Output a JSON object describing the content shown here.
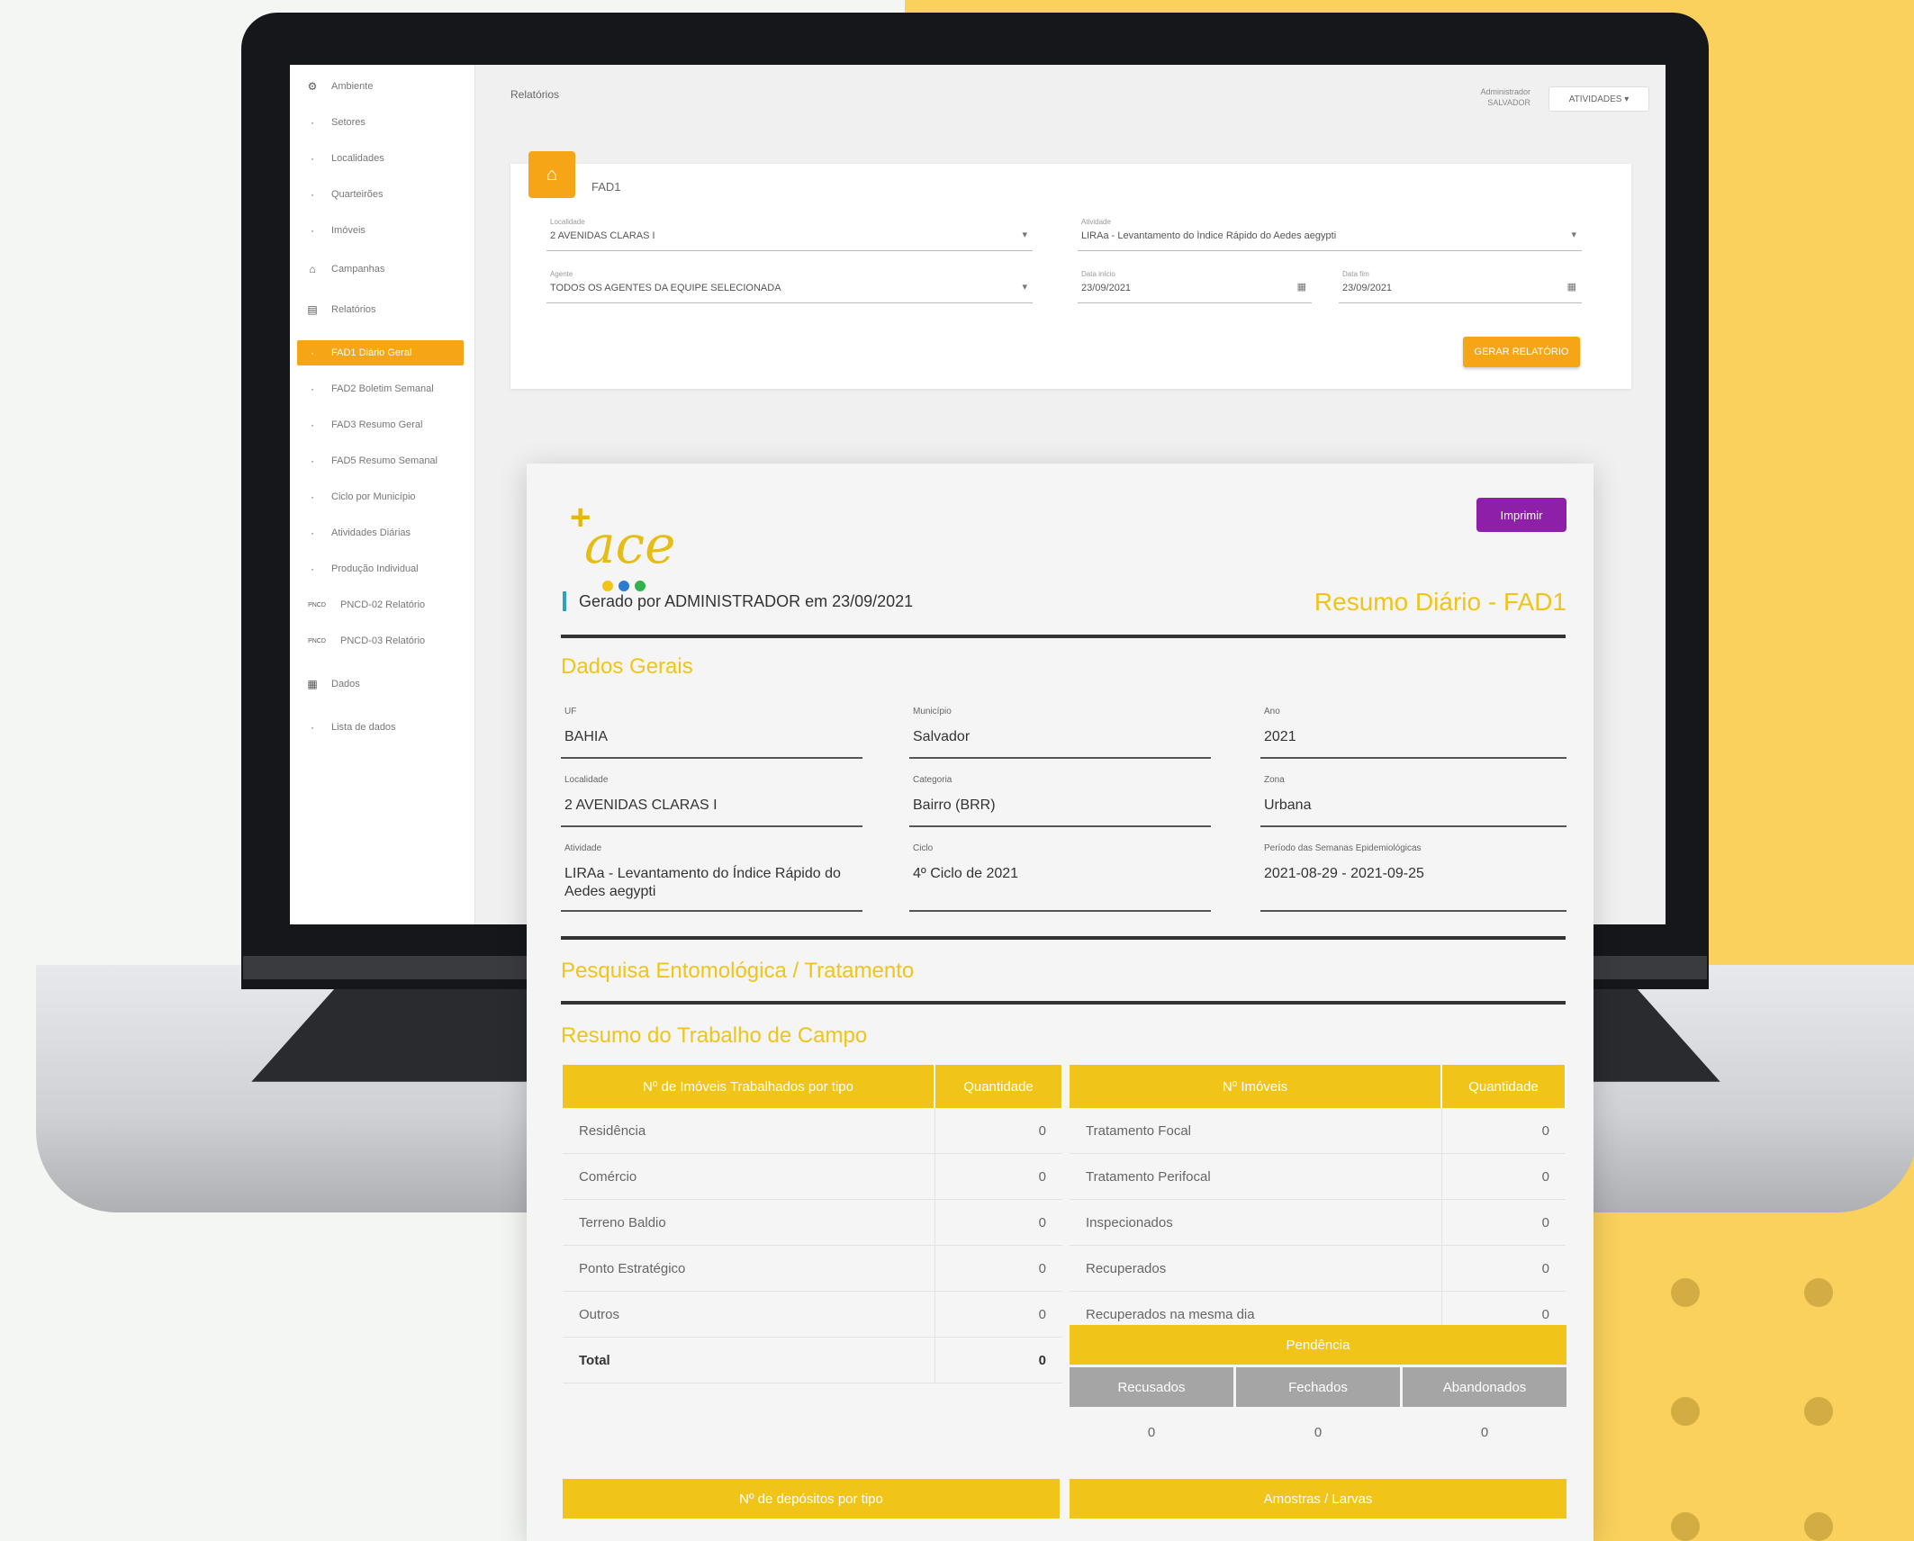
{
  "colors": {
    "accent": "#f6a516",
    "report_yellow": "#f0c419",
    "print": "#8e1fa8",
    "background_yellow": "#fad15c"
  },
  "sidebar": {
    "items": [
      {
        "icon": "gear-icon",
        "label": "Ambiente"
      },
      {
        "icon": "dot",
        "label": "Setores"
      },
      {
        "icon": "dot",
        "label": "Localidades"
      },
      {
        "icon": "dot",
        "label": "Quarteirões"
      },
      {
        "icon": "dot",
        "label": "Imóveis"
      },
      {
        "icon": "home-icon",
        "label": "Campanhas"
      },
      {
        "icon": "calendar-icon",
        "label": "Relatórios"
      },
      {
        "icon": "dot",
        "label": "FAD1 Diário Geral"
      },
      {
        "icon": "dot",
        "label": "FAD2 Boletim Semanal"
      },
      {
        "icon": "dot",
        "label": "FAD3 Resumo Geral"
      },
      {
        "icon": "dot",
        "label": "FAD5 Resumo Semanal"
      },
      {
        "icon": "dot",
        "label": "Ciclo por Município"
      },
      {
        "icon": "dot",
        "label": "Atividades Diárias"
      },
      {
        "icon": "dot",
        "label": "Produção Individual"
      },
      {
        "icon": "PNCD",
        "label": "PNCD-02 Relatório"
      },
      {
        "icon": "PNCD",
        "label": "PNCD-03 Relatório"
      },
      {
        "icon": "table-icon",
        "label": "Dados"
      },
      {
        "icon": "dot",
        "label": "Lista de dados"
      }
    ],
    "active_index": 7
  },
  "topbar": {
    "breadcrumb": "Relatórios",
    "user_line1": "Administrador",
    "user_line2": "SALVADOR",
    "user_button": "ATIVIDADES ▾"
  },
  "filter": {
    "title": "FAD1",
    "f1_label": "Localidade",
    "f1_value": "2 AVENIDAS CLARAS I",
    "f2_label": "Atividade",
    "f2_value": "LIRAa - Levantamento do Índice Rápido do Aedes aegypti",
    "f3_label": "Agente",
    "f3_value": "TODOS OS AGENTES DA EQUIPE SELECIONADA",
    "f4_label": "Data início",
    "f4_value": "23/09/2021",
    "f5_label": "Data fim",
    "f5_value": "23/09/2021",
    "generate": "GERAR RELATÓRIO"
  },
  "report": {
    "print_button": "Imprimir",
    "generated_by": "Gerado por ADMINISTRADOR em 23/09/2021",
    "title": "Resumo Diário - FAD1",
    "section_general": "Dados Gerais",
    "fields": [
      {
        "label": "UF",
        "value": "BAHIA"
      },
      {
        "label": "Município",
        "value": "Salvador"
      },
      {
        "label": "Ano",
        "value": "2021"
      },
      {
        "label": "Localidade",
        "value": "2 AVENIDAS CLARAS I"
      },
      {
        "label": "Categoria",
        "value": "Bairro (BRR)"
      },
      {
        "label": "Zona",
        "value": "Urbana"
      },
      {
        "label": "Atividade",
        "value": "LIRAa - Levantamento do Índice Rápido do Aedes aegypti"
      },
      {
        "label": "Ciclo",
        "value": "4º Ciclo de 2021"
      },
      {
        "label": "Período das Semanas Epidemiológicas",
        "value": "2021-08-29 - 2021-09-25"
      }
    ],
    "section_research": "Pesquisa Entomológica / Tratamento",
    "section_summary": "Resumo do Trabalho de Campo",
    "table_left": {
      "h1": "Nº de Imóveis Trabalhados por tipo",
      "h2": "Quantidade",
      "rows": [
        [
          "Residência",
          "0"
        ],
        [
          "Comércio",
          "0"
        ],
        [
          "Terreno Baldio",
          "0"
        ],
        [
          "Ponto Estratégico",
          "0"
        ],
        [
          "Outros",
          "0"
        ]
      ],
      "total_label": "Total",
      "total_value": "0"
    },
    "table_right": {
      "h1": "Nº Imóveis",
      "h2": "Quantidade",
      "rows": [
        [
          "Tratamento Focal",
          "0"
        ],
        [
          "Tratamento Perifocal",
          "0"
        ],
        [
          "Inspecionados",
          "0"
        ],
        [
          "Recuperados",
          "0"
        ],
        [
          "Recuperados na mesma dia",
          "0"
        ]
      ]
    },
    "pendencias": {
      "title": "Pendência",
      "cols": [
        "Recusados",
        "Fechados",
        "Abandonados"
      ],
      "values": [
        "0",
        "0",
        "0"
      ]
    },
    "bottom_left": "Nº de depósitos por tipo",
    "bottom_right": "Amostras / Larvas"
  }
}
